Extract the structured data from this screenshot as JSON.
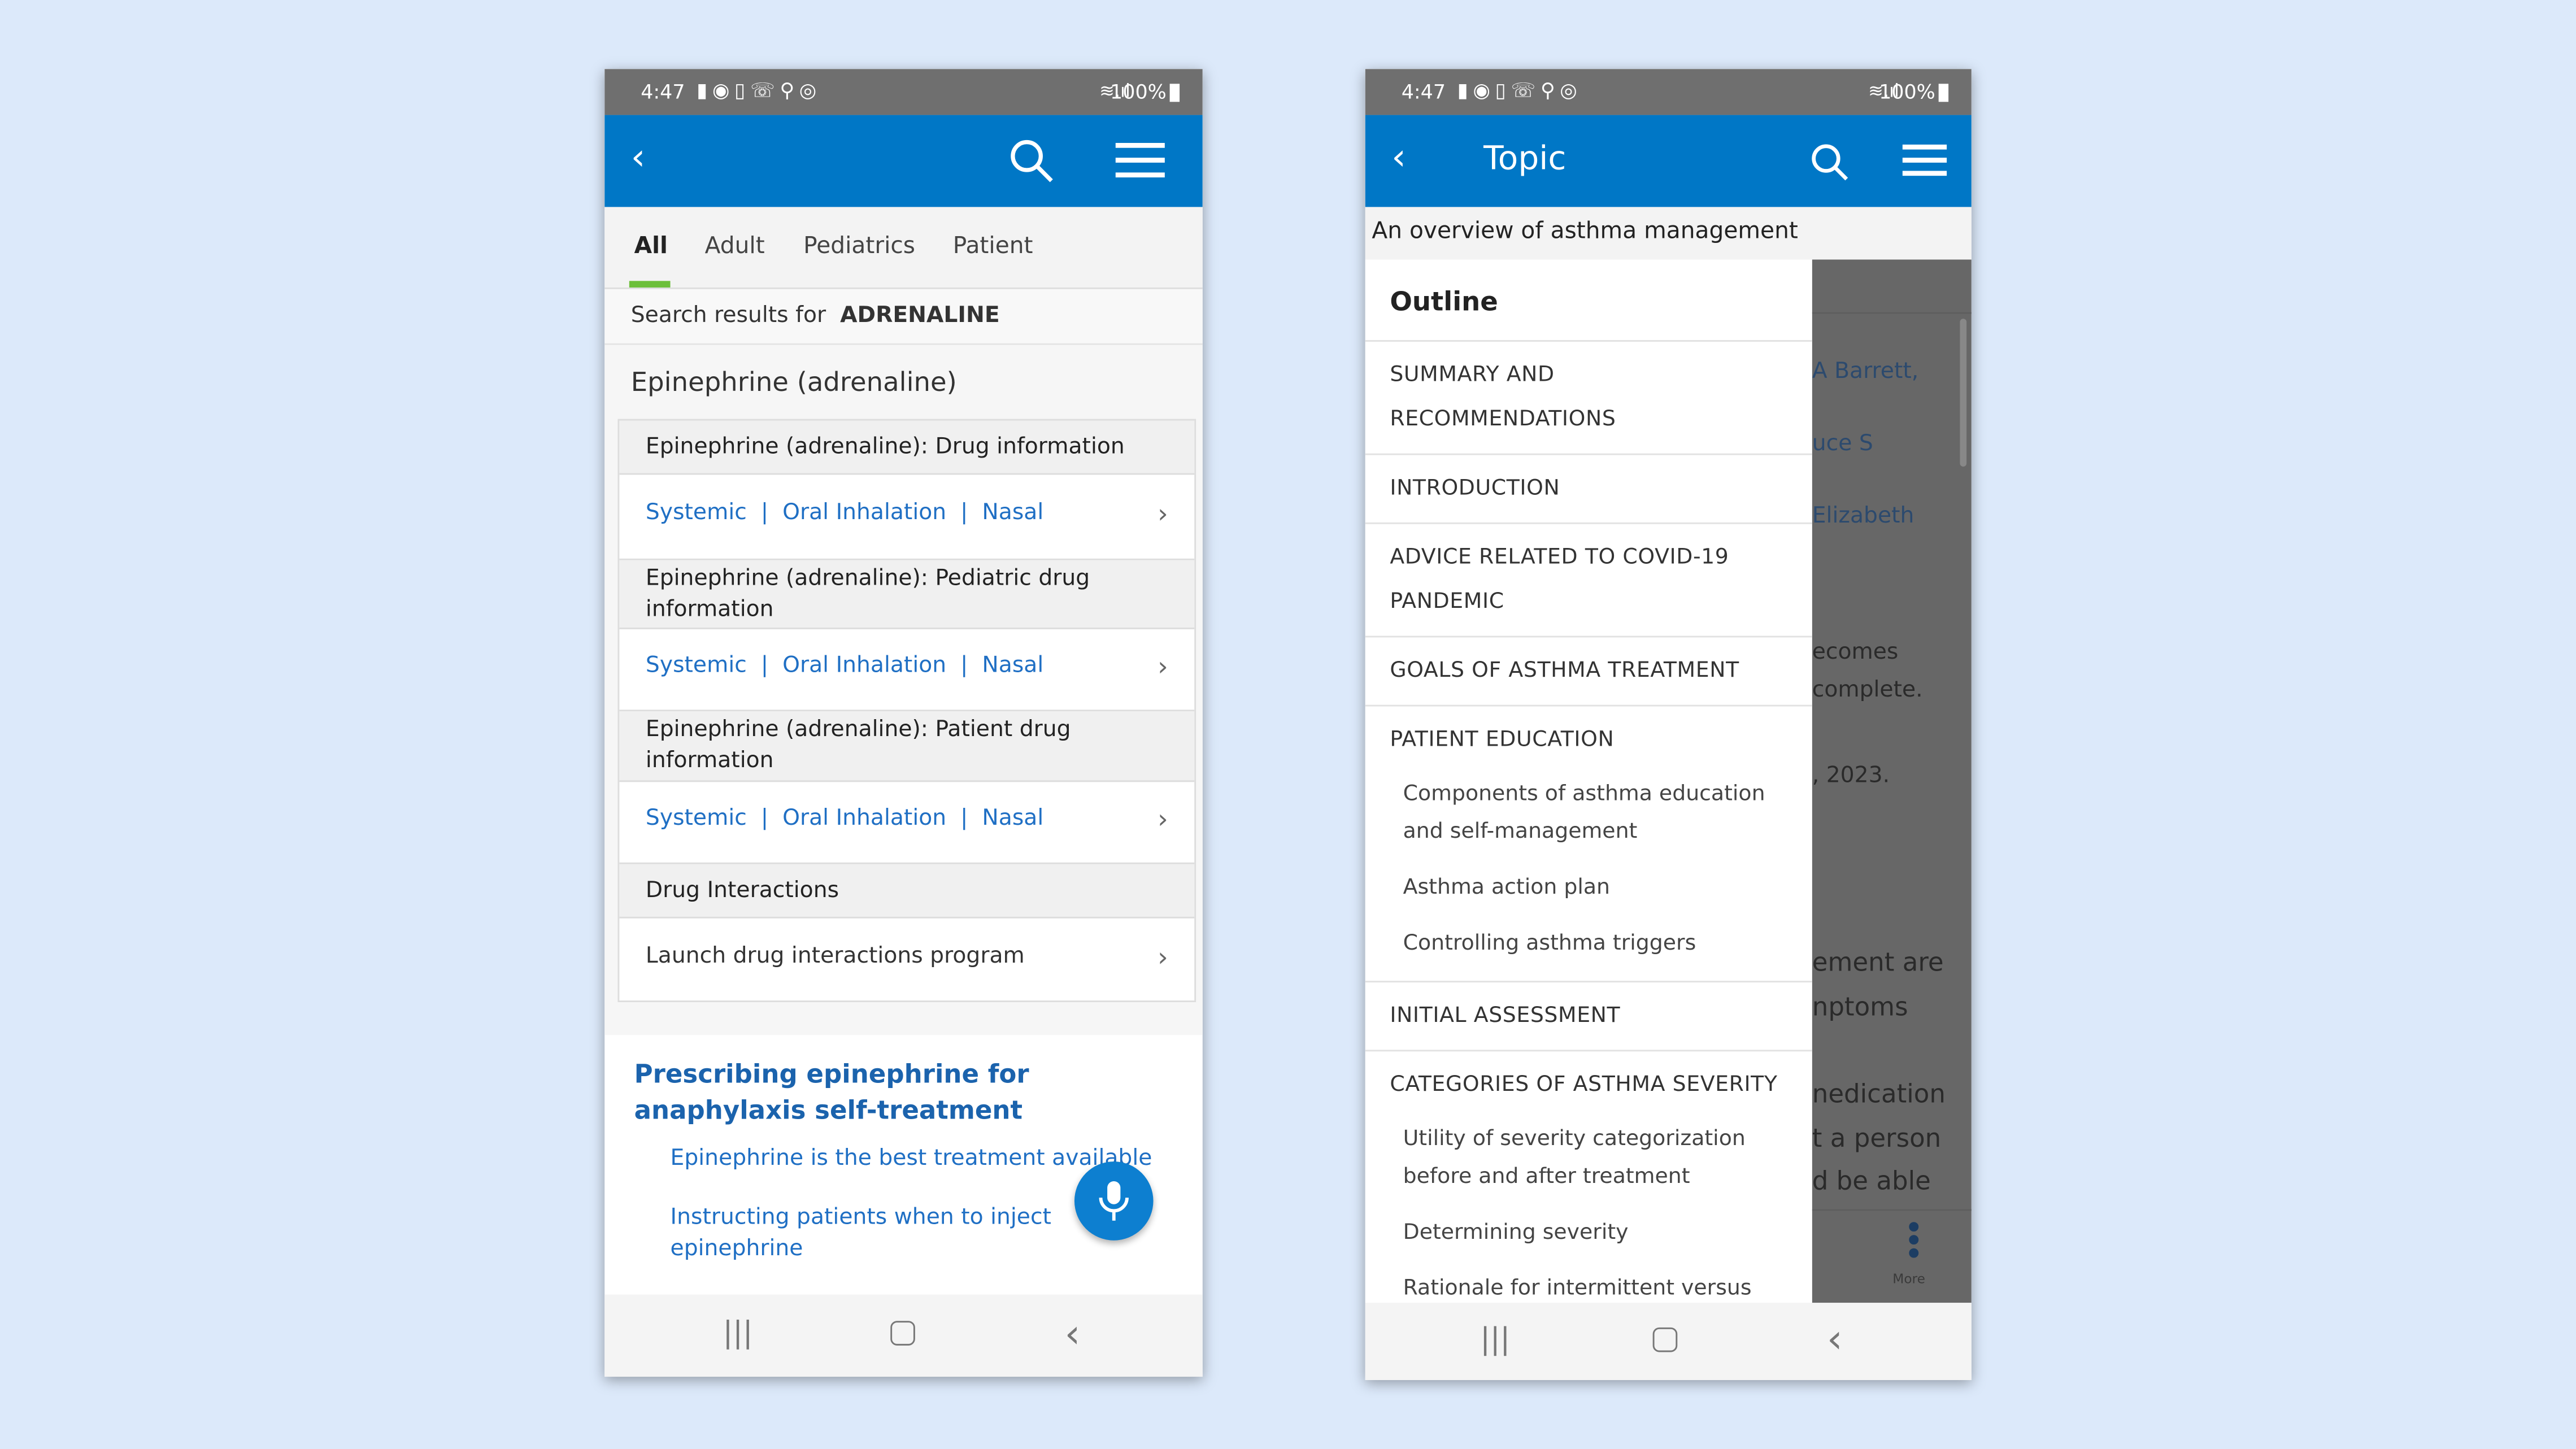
{
  "status": {
    "time": "4:47",
    "battery": "100%"
  },
  "left": {
    "tabs": [
      "All",
      "Adult",
      "Pediatrics",
      "Patient"
    ],
    "active_tab": "All",
    "accent": "#0077c6",
    "tab_indicator": "#6cbf3a",
    "search_label": "Search results for",
    "search_term": "ADRENALINE",
    "group_title": "Epinephrine (adrenaline)",
    "sections": [
      {
        "title": "Epinephrine (adrenaline): Drug information",
        "links": [
          "Systemic",
          "Oral Inhalation",
          "Nasal"
        ]
      },
      {
        "title": "Epinephrine (adrenaline): Pediatric drug information",
        "links": [
          "Systemic",
          "Oral Inhalation",
          "Nasal"
        ]
      },
      {
        "title": "Epinephrine (adrenaline): Patient drug information",
        "links": [
          "Systemic",
          "Oral Inhalation",
          "Nasal"
        ]
      }
    ],
    "interactions_title": "Drug Interactions",
    "interactions_link": "Launch drug interactions program",
    "separator": "|",
    "result_title": "Prescribing epinephrine for anaphylaxis self-treatment",
    "result_links": [
      "Epinephrine is the best treatment available",
      "Instructing patients when to inject epinephrine"
    ]
  },
  "right": {
    "title": "Topic",
    "subtitle": "An overview of asthma management",
    "outline_title": "Outline",
    "outline": [
      {
        "label": "SUMMARY AND RECOMMENDATIONS"
      },
      {
        "label": "INTRODUCTION"
      },
      {
        "label": "ADVICE RELATED TO COVID-19 PANDEMIC"
      },
      {
        "label": "GOALS OF ASTHMA TREATMENT"
      },
      {
        "label": "PATIENT EDUCATION",
        "children": [
          "Components of asthma education and self-management",
          "Asthma action plan",
          "Controlling asthma triggers"
        ]
      },
      {
        "label": "INITIAL ASSESSMENT"
      },
      {
        "label": "CATEGORIES OF ASTHMA SEVERITY",
        "children": [
          "Utility of severity categorization before and after treatment",
          "Determining severity",
          "Rationale for intermittent versus"
        ]
      }
    ],
    "background_text": [
      "A Barrett,",
      "uce S",
      "Elizabeth",
      "ecomes",
      "complete.",
      ", 2023.",
      "ement are",
      "nptoms",
      "nedication",
      "t a person",
      "d be able"
    ],
    "more_label": "More"
  }
}
